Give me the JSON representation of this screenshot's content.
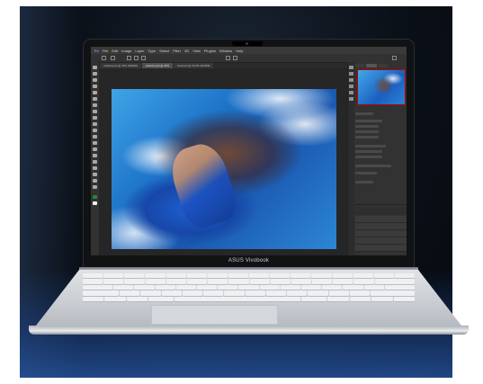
{
  "laptop": {
    "brand_text": "ASUS Vivobook"
  },
  "photoshop": {
    "menu": [
      "Ps",
      "File",
      "Edit",
      "Image",
      "Layer",
      "Type",
      "Select",
      "Filter",
      "3D",
      "View",
      "Plugins",
      "Window",
      "Help"
    ],
    "doc_tabs": [
      "untitled.psd @ 25% (RGB/8)",
      "artwork.psd @ 25%",
      "final.psd @ 33.3% (RGB/8)"
    ]
  },
  "colors": {
    "accent_blue": "#1d72c8",
    "backdrop": "#0b1018",
    "chassis_silver": "#d4d7db"
  }
}
